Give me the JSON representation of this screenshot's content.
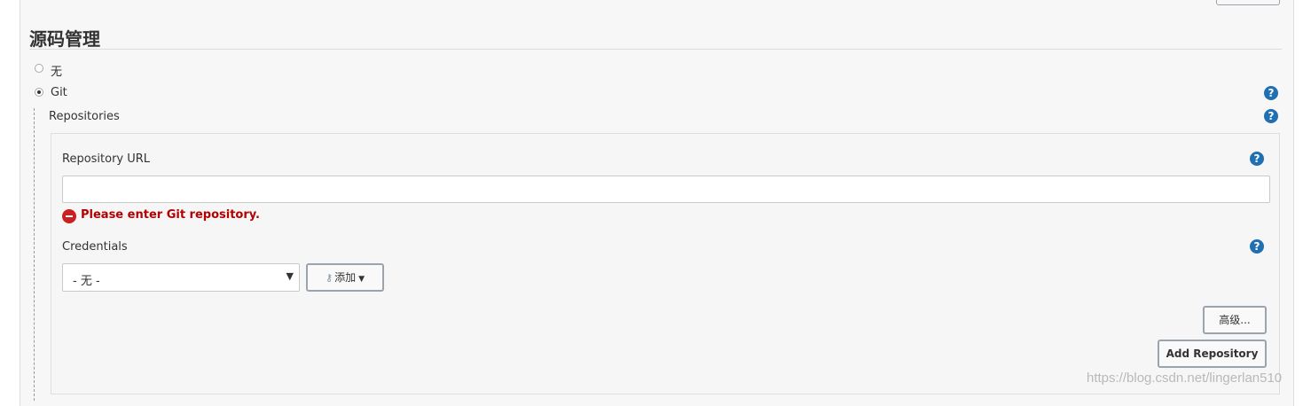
{
  "section": {
    "title": "源码管理"
  },
  "scm_options": [
    {
      "label": "无",
      "checked": false
    },
    {
      "label": "Git",
      "checked": true
    }
  ],
  "repositories": {
    "label": "Repositories",
    "url_label": "Repository URL",
    "url_value": "",
    "error": "Please enter Git repository.",
    "credentials_label": "Credentials",
    "credentials_selected": "- 无 -",
    "add_button": "添加",
    "advanced_button": "高级...",
    "add_repository_button": "Add Repository"
  },
  "help_icon_glyph": "?",
  "watermark": "https://blog.csdn.net/lingerlan510",
  "colors": {
    "help": "#1f6fb3",
    "error": "#b30000"
  }
}
